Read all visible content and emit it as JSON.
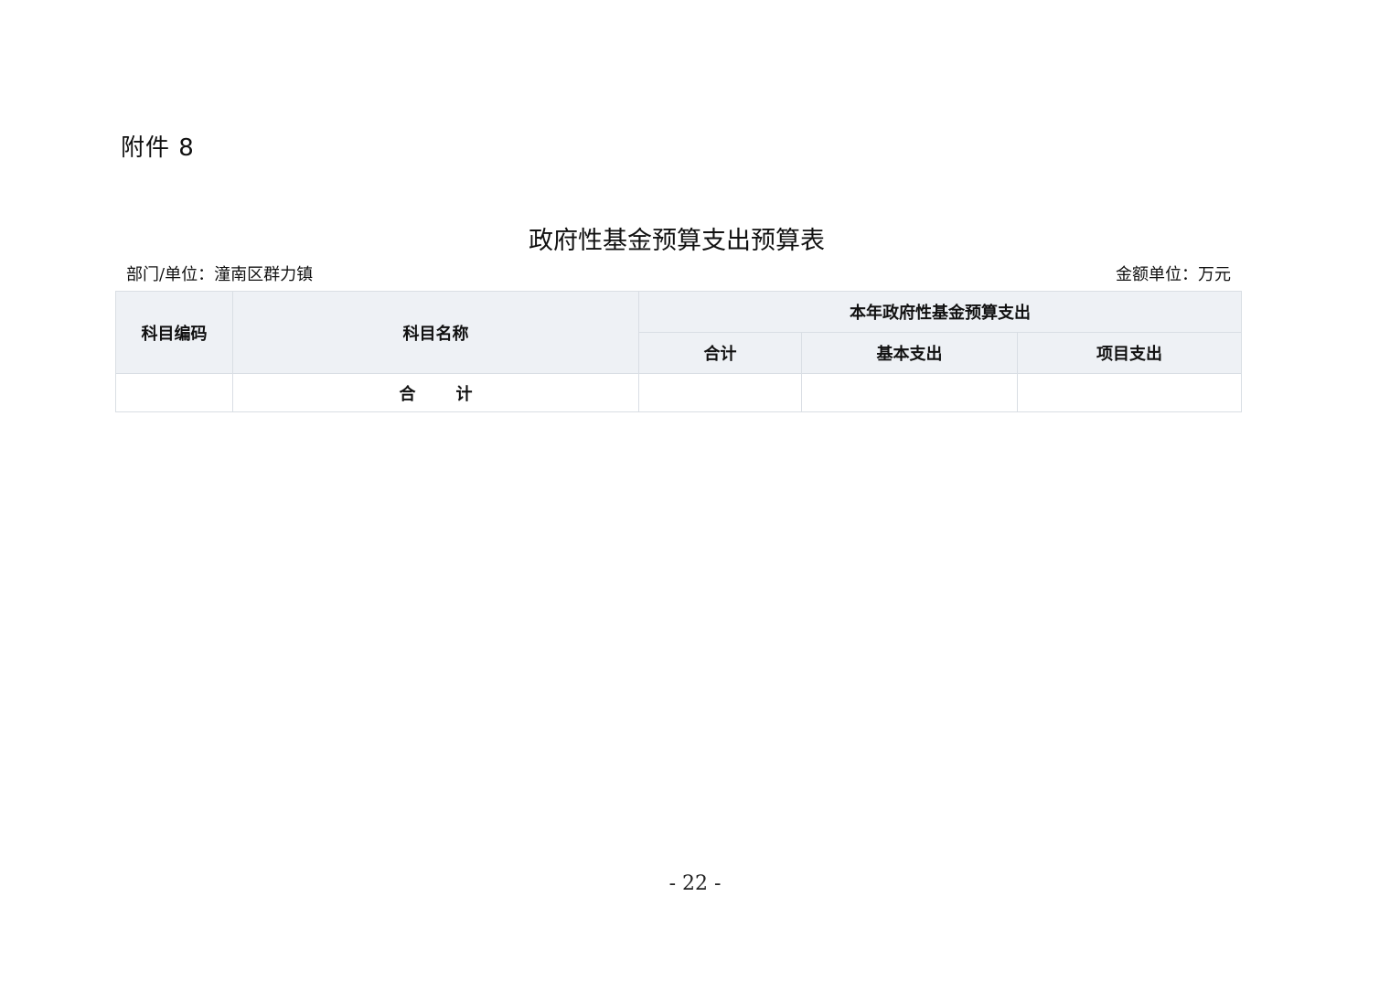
{
  "attachment": "附件 8",
  "title": "政府性基金预算支出预算表",
  "meta": {
    "department": "部门/单位：潼南区群力镇",
    "unit": "金额单位：万元"
  },
  "table": {
    "headers": {
      "code": "科目编码",
      "name": "科目名称",
      "group": "本年政府性基金预算支出",
      "total": "合计",
      "basic": "基本支出",
      "project": "项目支出"
    },
    "total_row": {
      "label_parts": [
        "合",
        "计"
      ],
      "code": "",
      "total": "",
      "basic": "",
      "project": ""
    }
  },
  "page_number": "- 22 -"
}
